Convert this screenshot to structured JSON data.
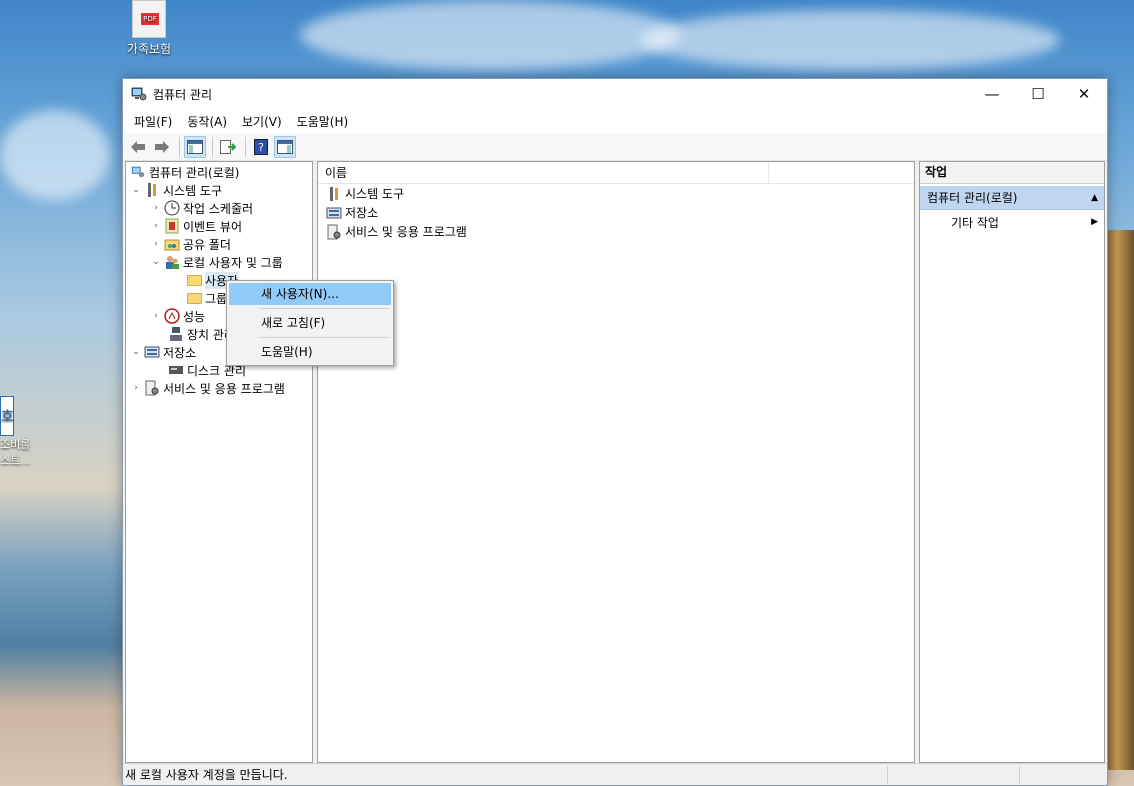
{
  "desktop": {
    "icon_label": "가족보험",
    "side_icon_label": "조비롤\n스트..."
  },
  "window": {
    "title": "컴퓨터 관리",
    "controls": {
      "minimize": "—",
      "maximize": "☐",
      "close": "✕"
    }
  },
  "menu": {
    "file": "파일(F)",
    "action": "동작(A)",
    "view": "보기(V)",
    "help": "도움말(H)"
  },
  "tree": {
    "root": "컴퓨터 관리(로컬)",
    "system_tools": "시스템 도구",
    "task_scheduler": "작업 스케줄러",
    "event_viewer": "이벤트 뷰어",
    "shared_folders": "공유 폴더",
    "local_users": "로컬 사용자 및 그룹",
    "users": "사용자",
    "groups": "그룹",
    "performance": "성능",
    "device_manager": "장치 관리자",
    "storage": "저장소",
    "disk_management": "디스크 관리",
    "services": "서비스 및 응용 프로그램"
  },
  "list": {
    "header_name": "이름",
    "items": [
      "시스템 도구",
      "저장소",
      "서비스 및 응용 프로그램"
    ]
  },
  "actions": {
    "title": "작업",
    "section": "컴퓨터 관리(로컬)",
    "more": "기타 작업"
  },
  "context_menu": {
    "new_user": "새 사용자(N)...",
    "refresh": "새로 고침(F)",
    "help": "도움말(H)"
  },
  "status": {
    "text": "새 로컬 사용자 계정을 만듭니다."
  }
}
